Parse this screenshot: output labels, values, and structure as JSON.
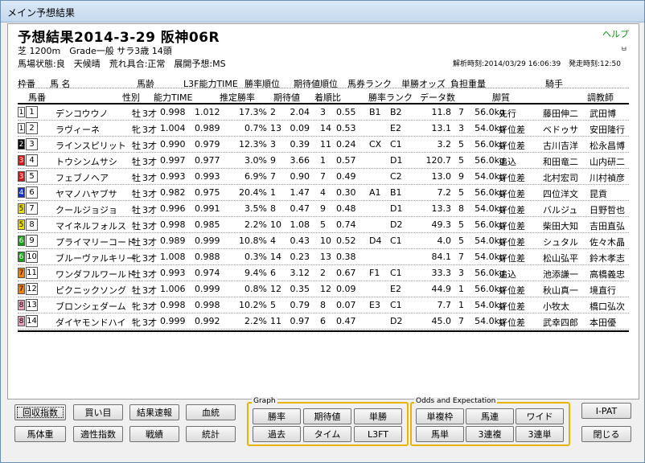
{
  "window": {
    "title": "メイン予想結果"
  },
  "header": {
    "title": "予想結果2014-3-29 阪神06R",
    "help": "ヘルプ",
    "pin": "ㅂ",
    "line1": "芝 1200m　Grade一般 サラ3歳 14頭",
    "line2": "馬場状態:良　天候晴　荒れ具合:正常　展開予想:MS",
    "analysis_time": "解析時刻:2014/03/29 16:06:39",
    "start_time": "発走時刻:12:50"
  },
  "columns_row1": [
    "枠番",
    "馬 名",
    "馬齢",
    "L3F能力TIME",
    "勝率順位",
    "期待値順位",
    "馬券ランク",
    "単勝オッズ",
    "負担重量",
    "騎手"
  ],
  "columns_row2": [
    "馬番",
    "性別",
    "能力TIME",
    "推定勝率",
    "期待値",
    "着順比",
    "勝率ランク",
    "データ数",
    "脚質",
    "調教師"
  ],
  "horses": [
    {
      "waku": "1",
      "waku_color": "#ffffff",
      "waku_text": "#000",
      "num": "1",
      "name": "デンコウウノ",
      "sex": "牡",
      "age": "3才",
      "ability": "0.998",
      "l3f": "1.012",
      "win_rate": "17.3%",
      "win_rank": "2",
      "expect": "2.04",
      "expect_rank": "3",
      "finish": "0.55",
      "ticket_rank": "B1",
      "rate_rank": "B2",
      "odds": "11.8",
      "data": "7",
      "weight": "56.0kg",
      "style": "先行",
      "jockey": "藤田伸二",
      "trainer": "武田博"
    },
    {
      "waku": "1",
      "waku_color": "#ffffff",
      "waku_text": "#000",
      "num": "2",
      "name": "ラヴィーネ",
      "sex": "牝",
      "age": "3才",
      "ability": "1.004",
      "l3f": "0.989",
      "win_rate": "0.7%",
      "win_rank": "13",
      "expect": "0.09",
      "expect_rank": "14",
      "finish": "0.53",
      "ticket_rank": "",
      "rate_rank": "E2",
      "odds": "13.1",
      "data": "3",
      "weight": "54.0kg",
      "style": "好位差",
      "jockey": "ベドゥサ",
      "trainer": "安田隆行"
    },
    {
      "waku": "2",
      "waku_color": "#000000",
      "waku_text": "#fff",
      "num": "3",
      "name": "ラインスピリット",
      "sex": "牡",
      "age": "3才",
      "ability": "0.990",
      "l3f": "0.979",
      "win_rate": "12.3%",
      "win_rank": "3",
      "expect": "0.39",
      "expect_rank": "11",
      "finish": "0.24",
      "ticket_rank": "CX",
      "rate_rank": "C1",
      "odds": "3.2",
      "data": "5",
      "weight": "56.0kg",
      "style": "好位差",
      "jockey": "古川吉洋",
      "trainer": "松永昌博"
    },
    {
      "waku": "3",
      "waku_color": "#e01010",
      "waku_text": "#fff",
      "num": "4",
      "name": "トウシンムサシ",
      "sex": "牡",
      "age": "3才",
      "ability": "0.997",
      "l3f": "0.977",
      "win_rate": "3.0%",
      "win_rank": "9",
      "expect": "3.66",
      "expect_rank": "1",
      "finish": "0.57",
      "ticket_rank": "",
      "rate_rank": "D1",
      "odds": "120.7",
      "data": "5",
      "weight": "56.0kg",
      "style": "追込",
      "jockey": "和田竜二",
      "trainer": "山内研二"
    },
    {
      "waku": "3",
      "waku_color": "#e01010",
      "waku_text": "#fff",
      "num": "5",
      "name": "フェブノヘア",
      "sex": "牡",
      "age": "3才",
      "ability": "0.993",
      "l3f": "0.993",
      "win_rate": "6.9%",
      "win_rank": "7",
      "expect": "0.90",
      "expect_rank": "7",
      "finish": "0.49",
      "ticket_rank": "",
      "rate_rank": "C2",
      "odds": "13.0",
      "data": "9",
      "weight": "54.0kg",
      "style": "好位差",
      "jockey": "北村宏司",
      "trainer": "川村禎彦"
    },
    {
      "waku": "4",
      "waku_color": "#1030d0",
      "waku_text": "#fff",
      "num": "6",
      "name": "ヤマノハヤブサ",
      "sex": "牡",
      "age": "3才",
      "ability": "0.982",
      "l3f": "0.975",
      "win_rate": "20.4%",
      "win_rank": "1",
      "expect": "1.47",
      "expect_rank": "4",
      "finish": "0.30",
      "ticket_rank": "A1",
      "rate_rank": "B1",
      "odds": "7.2",
      "data": "5",
      "weight": "56.0kg",
      "style": "好位差",
      "jockey": "四位洋文",
      "trainer": "昆貢"
    },
    {
      "waku": "5",
      "waku_color": "#f0e000",
      "waku_text": "#000",
      "num": "7",
      "name": "クールジョジョ",
      "sex": "牡",
      "age": "3才",
      "ability": "0.996",
      "l3f": "0.991",
      "win_rate": "3.5%",
      "win_rank": "8",
      "expect": "0.47",
      "expect_rank": "9",
      "finish": "0.48",
      "ticket_rank": "",
      "rate_rank": "D1",
      "odds": "13.3",
      "data": "8",
      "weight": "54.0kg",
      "style": "好位差",
      "jockey": "バルジュ",
      "trainer": "日野哲也"
    },
    {
      "waku": "5",
      "waku_color": "#f0e000",
      "waku_text": "#000",
      "num": "8",
      "name": "マイネルフォルス",
      "sex": "牡",
      "age": "3才",
      "ability": "0.998",
      "l3f": "0.985",
      "win_rate": "2.2%",
      "win_rank": "10",
      "expect": "1.08",
      "expect_rank": "5",
      "finish": "0.74",
      "ticket_rank": "",
      "rate_rank": "D2",
      "odds": "49.3",
      "data": "5",
      "weight": "56.0kg",
      "style": "好位差",
      "jockey": "柴田大知",
      "trainer": "吉田直弘"
    },
    {
      "waku": "6",
      "waku_color": "#10a010",
      "waku_text": "#fff",
      "num": "9",
      "name": "プライマリーコード",
      "sex": "牡",
      "age": "3才",
      "ability": "0.989",
      "l3f": "0.999",
      "win_rate": "10.8%",
      "win_rank": "4",
      "expect": "0.43",
      "expect_rank": "10",
      "finish": "0.52",
      "ticket_rank": "D4",
      "rate_rank": "C1",
      "odds": "4.0",
      "data": "5",
      "weight": "54.0kg",
      "style": "好位差",
      "jockey": "シュタル",
      "trainer": "佐々木晶"
    },
    {
      "waku": "6",
      "waku_color": "#10a010",
      "waku_text": "#fff",
      "num": "10",
      "name": "ブルーヴァルキリー",
      "sex": "牝",
      "age": "3才",
      "ability": "1.008",
      "l3f": "0.988",
      "win_rate": "0.3%",
      "win_rank": "14",
      "expect": "0.23",
      "expect_rank": "13",
      "finish": "0.38",
      "ticket_rank": "",
      "rate_rank": "",
      "odds": "84.1",
      "data": "7",
      "weight": "54.0kg",
      "style": "好位差",
      "jockey": "松山弘平",
      "trainer": "鈴木孝志"
    },
    {
      "waku": "7",
      "waku_color": "#f08000",
      "waku_text": "#000",
      "num": "11",
      "name": "ワンダフルワールド",
      "sex": "牡",
      "age": "3才",
      "ability": "0.993",
      "l3f": "0.974",
      "win_rate": "9.4%",
      "win_rank": "6",
      "expect": "3.12",
      "expect_rank": "2",
      "finish": "0.67",
      "ticket_rank": "F1",
      "rate_rank": "C1",
      "odds": "33.3",
      "data": "3",
      "weight": "56.0kg",
      "style": "追込",
      "jockey": "池添謙一",
      "trainer": "高橋義忠"
    },
    {
      "waku": "7",
      "waku_color": "#f08000",
      "waku_text": "#000",
      "num": "12",
      "name": "ピクニックソング",
      "sex": "牡",
      "age": "3才",
      "ability": "1.006",
      "l3f": "0.999",
      "win_rate": "0.8%",
      "win_rank": "12",
      "expect": "0.35",
      "expect_rank": "12",
      "finish": "0.09",
      "ticket_rank": "",
      "rate_rank": "E2",
      "odds": "44.9",
      "data": "1",
      "weight": "56.0kg",
      "style": "好位差",
      "jockey": "秋山真一",
      "trainer": "境直行"
    },
    {
      "waku": "8",
      "waku_color": "#f0a0b8",
      "waku_text": "#000",
      "num": "13",
      "name": "ブロンシェダーム",
      "sex": "牝",
      "age": "3才",
      "ability": "0.998",
      "l3f": "0.998",
      "win_rate": "10.2%",
      "win_rank": "5",
      "expect": "0.79",
      "expect_rank": "8",
      "finish": "0.07",
      "ticket_rank": "E3",
      "rate_rank": "C1",
      "odds": "7.7",
      "data": "1",
      "weight": "54.0kg",
      "style": "好位差",
      "jockey": "小牧太",
      "trainer": "橋口弘次"
    },
    {
      "waku": "8",
      "waku_color": "#f0a0b8",
      "waku_text": "#000",
      "num": "14",
      "name": "ダイヤモンドハイ",
      "sex": "牝",
      "age": "3才",
      "ability": "0.999",
      "l3f": "0.992",
      "win_rate": "2.2%",
      "win_rank": "11",
      "expect": "0.97",
      "expect_rank": "6",
      "finish": "0.47",
      "ticket_rank": "",
      "rate_rank": "D2",
      "odds": "45.0",
      "data": "7",
      "weight": "54.0kg",
      "style": "好位差",
      "jockey": "武幸四郎",
      "trainer": "本田優"
    }
  ],
  "buttons": {
    "kaishu": "回収指数",
    "kaime": "買い目",
    "kekka": "結果速報",
    "ketto": "血統",
    "bataiju": "馬体重",
    "tekisei": "適性指数",
    "senseki": "戦績",
    "tokei": "統計",
    "graph_label": "Graph",
    "shoritsu": "勝率",
    "kitaichi": "期待値",
    "tansho": "単勝",
    "kako": "過去",
    "time": "タイム",
    "l3ft": "L3FT",
    "odds_label": "Odds and Expectation",
    "tanfukuwaku": "単複枠",
    "umaren": "馬連",
    "wide": "ワイド",
    "umatan": "馬単",
    "sanrenpuku": "3連複",
    "sanrentan": "3連単",
    "ipat": "I-PAT",
    "close": "閉じる"
  }
}
